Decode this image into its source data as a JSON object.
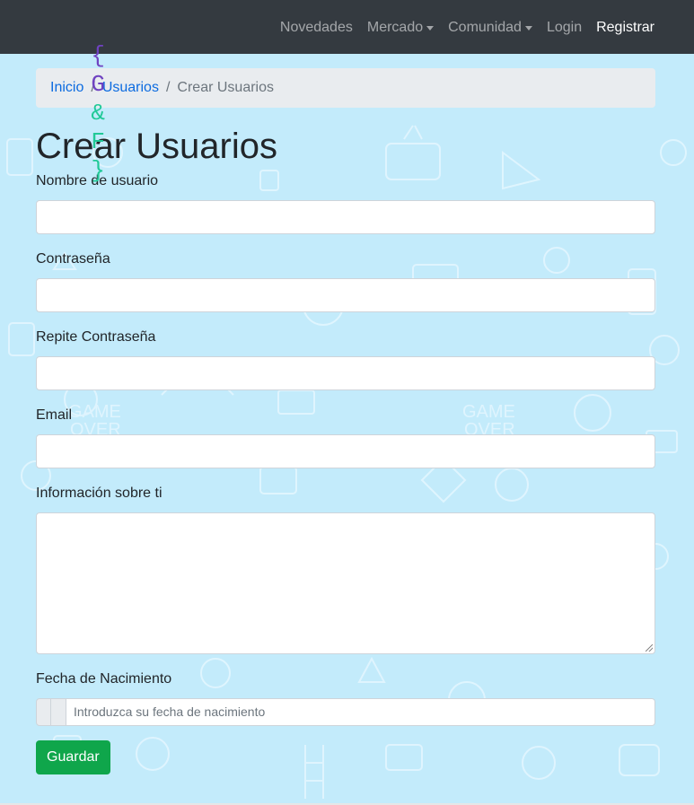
{
  "navbar": {
    "brand_open": "{",
    "brand_g": "G",
    "brand_amp": "&",
    "brand_f": "F",
    "brand_close": "}",
    "links": [
      {
        "label": "Novedades",
        "dropdown": false
      },
      {
        "label": "Mercado",
        "dropdown": true
      },
      {
        "label": "Comunidad",
        "dropdown": true
      },
      {
        "label": "Login",
        "dropdown": false
      },
      {
        "label": "Registrar",
        "dropdown": false
      }
    ]
  },
  "breadcrumb": {
    "items": [
      "Inicio",
      "Usuarios"
    ],
    "separator": "/",
    "current": "Crear Usuarios"
  },
  "page": {
    "title": "Crear Usuarios"
  },
  "form": {
    "username_label": "Nombre de usuario",
    "username_value": "",
    "password_label": "Contraseña",
    "password_value": "",
    "repeat_password_label": "Repite Contraseña",
    "repeat_password_value": "",
    "email_label": "Email",
    "email_value": "",
    "about_label": "Información sobre ti",
    "about_value": "",
    "birthdate_label": "Fecha de Nacimiento",
    "birthdate_placeholder": "Introduzca su fecha de nacimiento",
    "submit_label": "Guardar"
  },
  "colors": {
    "navbar_bg": "#343a40",
    "page_bg": "#c3ebfb",
    "link": "#0c6be0",
    "submit_bg": "#0fa64b",
    "brand_braces": "#6f42c1",
    "brand_letters": "#20c997"
  }
}
